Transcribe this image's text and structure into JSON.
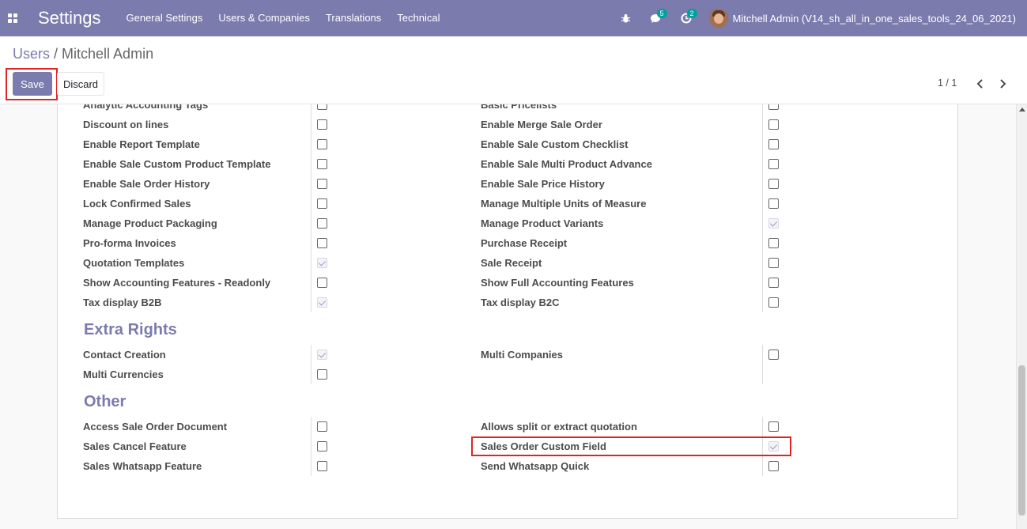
{
  "navbar": {
    "brand": "Settings",
    "menu": [
      "General Settings",
      "Users & Companies",
      "Translations",
      "Technical"
    ],
    "messages_count": "5",
    "activities_count": "2",
    "user_label": "Mitchell Admin (V14_sh_all_in_one_sales_tools_24_06_2021)"
  },
  "breadcrumb": {
    "parent": "Users",
    "separator": "/",
    "current": "Mitchell Admin"
  },
  "buttons": {
    "save": "Save",
    "discard": "Discard"
  },
  "pager": {
    "value": "1 / 1"
  },
  "sections": {
    "top_rows": [
      {
        "left": "Analytic Accounting Tags",
        "left_checked": false,
        "right": "Basic Pricelists",
        "right_checked": false
      },
      {
        "left": "Discount on lines",
        "left_checked": false,
        "right": "Enable Merge Sale Order",
        "right_checked": false
      },
      {
        "left": "Enable Report Template",
        "left_checked": false,
        "right": "Enable Sale Custom Checklist",
        "right_checked": false
      },
      {
        "left": "Enable Sale Custom Product Template",
        "left_checked": false,
        "right": "Enable Sale Multi Product Advance",
        "right_checked": false
      },
      {
        "left": "Enable Sale Order History",
        "left_checked": false,
        "right": "Enable Sale Price History",
        "right_checked": false
      },
      {
        "left": "Lock Confirmed Sales",
        "left_checked": false,
        "right": "Manage Multiple Units of Measure",
        "right_checked": false
      },
      {
        "left": "Manage Product Packaging",
        "left_checked": false,
        "right": "Manage Product Variants",
        "right_checked": true
      },
      {
        "left": "Pro-forma Invoices",
        "left_checked": false,
        "right": "Purchase Receipt",
        "right_checked": false
      },
      {
        "left": "Quotation Templates",
        "left_checked": true,
        "right": "Sale Receipt",
        "right_checked": false
      },
      {
        "left": "Show Accounting Features - Readonly",
        "left_checked": false,
        "right": "Show Full Accounting Features",
        "right_checked": false
      },
      {
        "left": "Tax display B2B",
        "left_checked": true,
        "right": "Tax display B2C",
        "right_checked": false
      }
    ],
    "extra_rights": {
      "title": "Extra Rights",
      "rows": [
        {
          "left": "Contact Creation",
          "left_checked": true,
          "right": "Multi Companies",
          "right_checked": false
        },
        {
          "left": "Multi Currencies",
          "left_checked": false,
          "right": "",
          "right_checked": null
        }
      ]
    },
    "other": {
      "title": "Other",
      "rows": [
        {
          "left": "Access Sale Order Document",
          "left_checked": false,
          "right": "Allows split or extract quotation",
          "right_checked": false
        },
        {
          "left": "Sales Cancel Feature",
          "left_checked": false,
          "right": "Sales Order Custom Field",
          "right_checked": true
        },
        {
          "left": "Sales Whatsapp Feature",
          "left_checked": false,
          "right": "Send Whatsapp Quick",
          "right_checked": false
        }
      ]
    }
  },
  "colors": {
    "primary": "#7c7bad",
    "highlight": "#e02424"
  }
}
